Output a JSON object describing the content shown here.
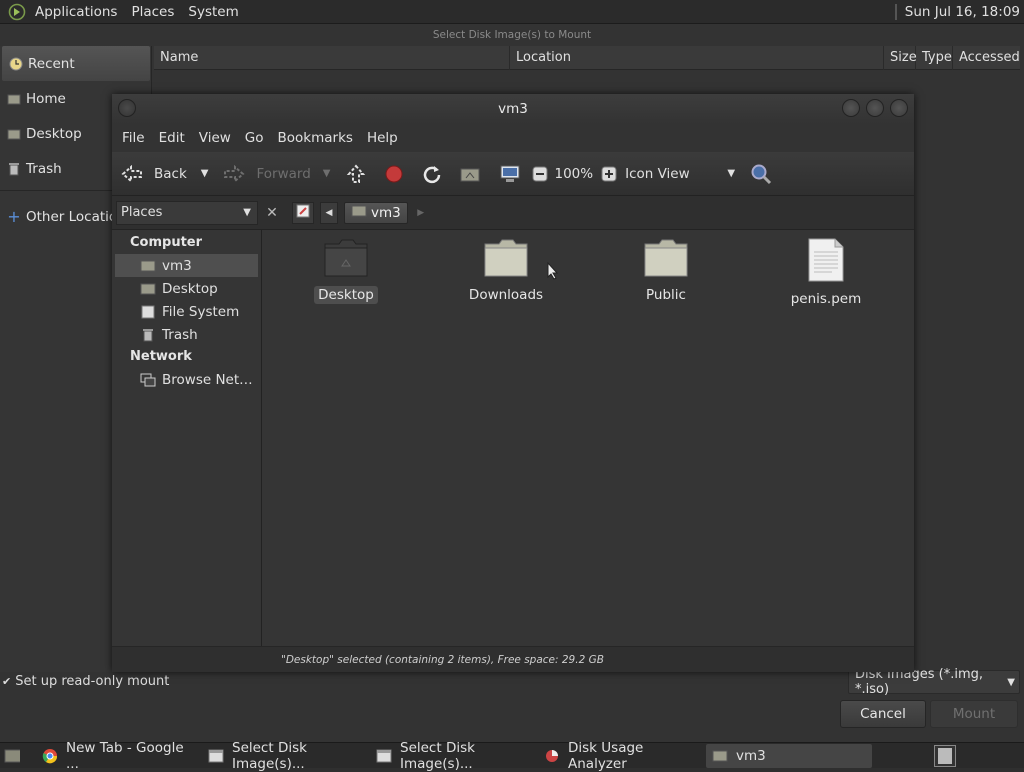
{
  "top_panel": {
    "menus": [
      "Applications",
      "Places",
      "System"
    ],
    "clock": "Sun Jul 16, 18:09"
  },
  "bg_dialog": {
    "title": "Select Disk Image(s) to Mount",
    "sidebar": [
      "Recent",
      "Home",
      "Desktop",
      "Trash",
      "Other Locations"
    ],
    "columns": [
      "Name",
      "Location",
      "Size",
      "Type",
      "Accessed"
    ],
    "readonly_label": "Set up read-only mount",
    "filter_value": "Disk Images (*.img, *.iso)",
    "cancel_label": "Cancel",
    "mount_label": "Mount"
  },
  "fm": {
    "title": "vm3",
    "menus": [
      "File",
      "Edit",
      "View",
      "Go",
      "Bookmarks",
      "Help"
    ],
    "toolbar": {
      "back": "Back",
      "forward": "Forward",
      "zoom": "100%",
      "view_mode": "Icon View"
    },
    "places_combo": "Places",
    "breadcrumb": "vm3",
    "sidebar": {
      "computer_heading": "Computer",
      "computer_items": [
        "vm3",
        "Desktop",
        "File System",
        "Trash"
      ],
      "network_heading": "Network",
      "network_items": [
        "Browse Net…"
      ]
    },
    "files": [
      {
        "name": "Desktop",
        "type": "folder-dark"
      },
      {
        "name": "Downloads",
        "type": "folder"
      },
      {
        "name": "Public",
        "type": "folder"
      },
      {
        "name": "penis.pem",
        "type": "text-file"
      }
    ],
    "status": "\"Desktop\" selected (containing 2 items), Free space: 29.2 GB"
  },
  "taskbar": {
    "items": [
      "New Tab - Google ...",
      "Select Disk Image(s)...",
      "Select Disk Image(s)...",
      "Disk Usage Analyzer",
      "vm3"
    ]
  },
  "colors": {
    "background": "#2f2f2f",
    "panel": "#2b2b2b",
    "selection": "#4f4f4f",
    "text": "#e0e0e0"
  }
}
